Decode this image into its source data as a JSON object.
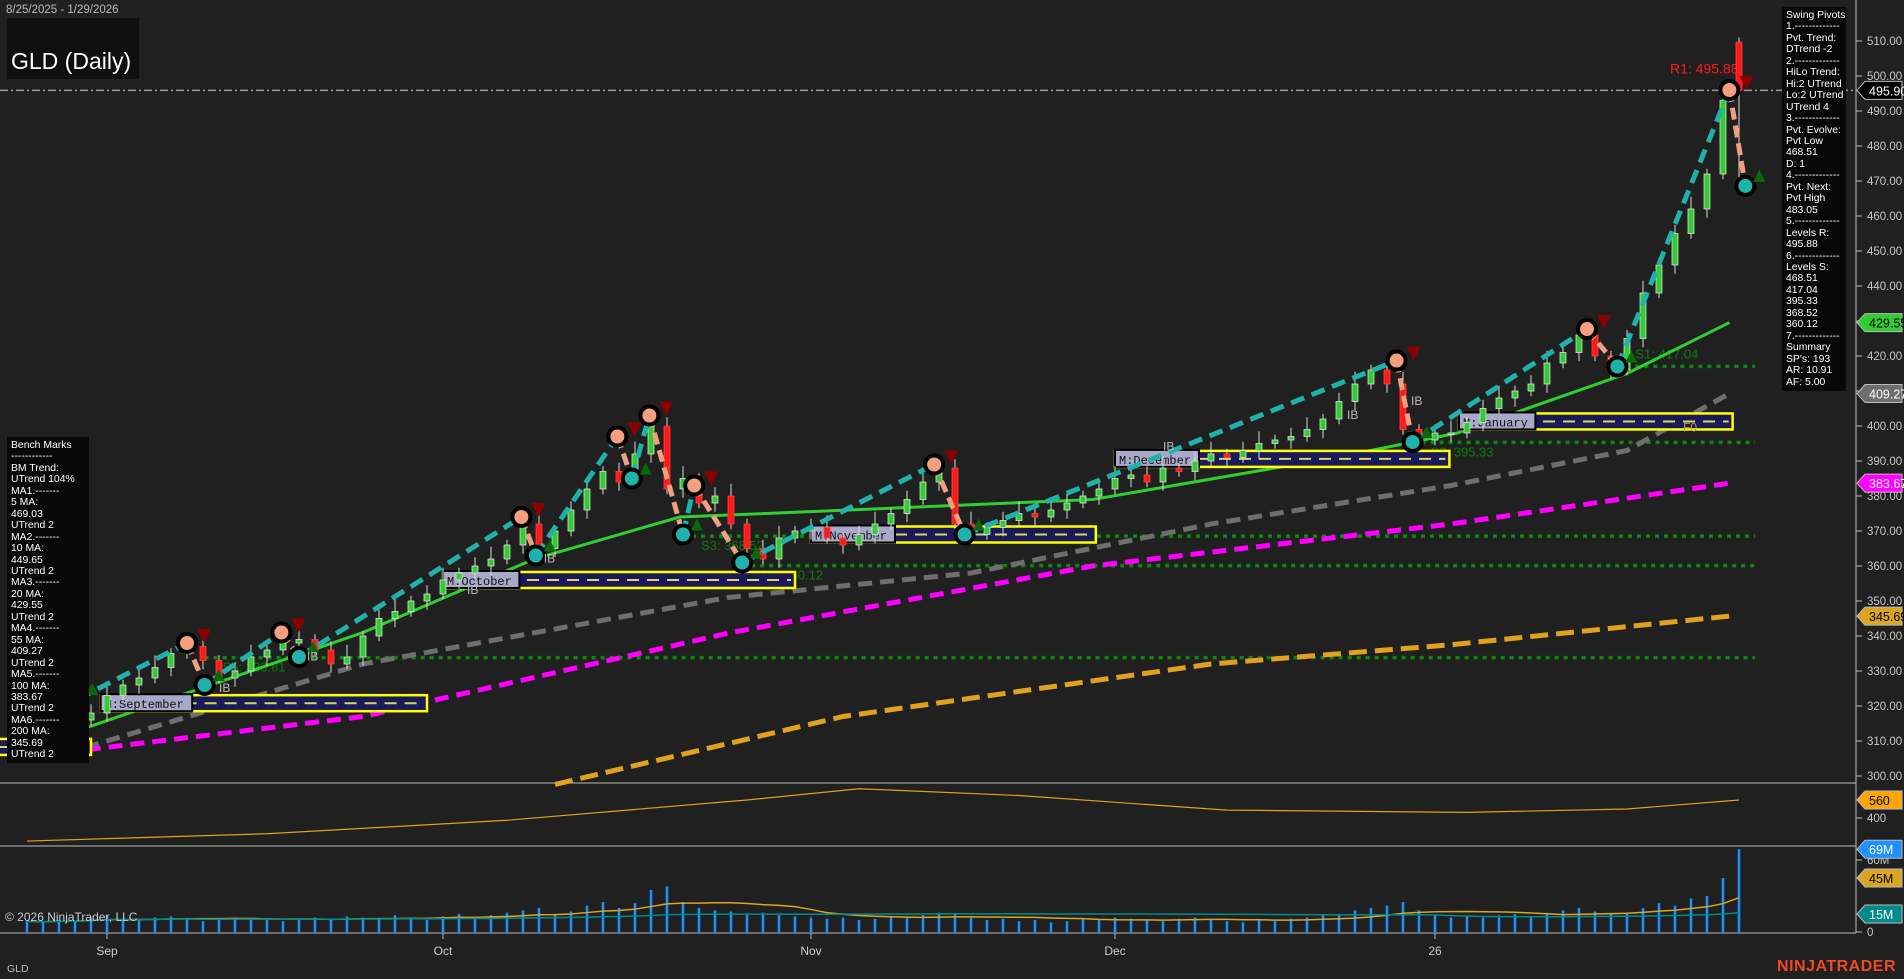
{
  "header": {
    "date_range": "8/25/2025 - 1/29/2026",
    "title": "GLD (Daily)"
  },
  "bench_marks": [
    "Bench Marks",
    "------------",
    "BM Trend:",
    "UTrend 104%",
    "MA1.-------",
    "5 MA:",
    "469.03",
    "UTrend 2",
    "MA2.-------",
    "10 MA:",
    "449.65",
    "UTrend 2",
    "MA3.-------",
    "20 MA:",
    "429.55",
    "UTrend 2",
    "MA4.-------",
    "55 MA:",
    "409.27",
    "UTrend 2",
    "MA5.-------",
    "100 MA:",
    "383.67",
    "UTrend 2",
    "MA6.-------",
    "200 MA:",
    "345.69",
    "UTrend 2"
  ],
  "swing_pivots": [
    "Swing Pivots",
    "1.-------------",
    "Pvt. Trend:",
    "DTrend -2",
    "2.-------------",
    "HiLo Trend:",
    "Hi:2 UTrend",
    "Lo:2 UTrend",
    "UTrend 4",
    "3.-------------",
    "Pvt. Evolve:",
    "Pvt Low",
    "468.51",
    "D: 1",
    "4.-------------",
    "Pvt. Next:",
    "Pvt High",
    "483.05",
    "5.-------------",
    "Levels R:",
    "495.88",
    "6.-------------",
    "Levels S:",
    "468.51",
    "417.04",
    "395.33",
    "368.52",
    "360.12",
    "7.-------------",
    "Summary",
    "SP's: 193",
    "AR: 10.91",
    "AF: 5.00"
  ],
  "footer": {
    "copyright": "© 2026 NinjaTrader, LLC",
    "symbol": "GLD",
    "logo": "NINJATRADER"
  },
  "chart_data": {
    "type": "candlestick",
    "symbol": "GLD",
    "interval": "Daily",
    "x_labels": [
      {
        "label": "Sep",
        "bar": 5
      },
      {
        "label": "Oct",
        "bar": 26
      },
      {
        "label": "Nov",
        "bar": 49
      },
      {
        "label": "Dec",
        "bar": 68
      },
      {
        "label": "26",
        "bar": 88
      }
    ],
    "price_axis": {
      "min": 300,
      "max": 510,
      "step": 10,
      "tick_labels": [
        "300.00",
        "310.00",
        "320.00",
        "330.00",
        "340.00",
        "350.00",
        "360.00",
        "370.00",
        "380.00",
        "390.00",
        "400.00",
        "410.00",
        "420.00",
        "430.00",
        "440.00",
        "450.00",
        "460.00",
        "470.00",
        "480.00",
        "490.00",
        "500.00",
        "510.00"
      ]
    },
    "closes": [
      312,
      313,
      314,
      316,
      318,
      323,
      326,
      328,
      331,
      335,
      337,
      333,
      328,
      330,
      334,
      336,
      338,
      339,
      336,
      332,
      334,
      340,
      345,
      347,
      350,
      352,
      356,
      358,
      360,
      362,
      366,
      372,
      365,
      370,
      376,
      382,
      387,
      384,
      392,
      400,
      382,
      385,
      378,
      380,
      372,
      365,
      362,
      368,
      370,
      371,
      368,
      366,
      369,
      372,
      375,
      379,
      384,
      388,
      372,
      369,
      371,
      373,
      375,
      374,
      376,
      378,
      380,
      382,
      385,
      386,
      384,
      388,
      387,
      390,
      392,
      391,
      393,
      395,
      396,
      397,
      399,
      402,
      407,
      412,
      416,
      412,
      399,
      396,
      398,
      398,
      401,
      405,
      408,
      410,
      412,
      418,
      421,
      426,
      420,
      416,
      425,
      438,
      446,
      455,
      462,
      472,
      493,
      496
    ],
    "last_bar": {
      "open": 509.7,
      "high": 511,
      "low": 468.51,
      "close": 495.9
    },
    "volume_millions": [
      9,
      8,
      10,
      9,
      12,
      14,
      11,
      10,
      12,
      13,
      11,
      9,
      10,
      12,
      11,
      10,
      9,
      11,
      12,
      10,
      13,
      12,
      11,
      14,
      12,
      10,
      13,
      15,
      12,
      14,
      16,
      18,
      20,
      15,
      17,
      22,
      25,
      20,
      24,
      35,
      38,
      25,
      20,
      18,
      17,
      15,
      16,
      14,
      13,
      12,
      11,
      12,
      10,
      11,
      13,
      12,
      14,
      16,
      15,
      12,
      10,
      11,
      9,
      10,
      8,
      9,
      11,
      10,
      12,
      11,
      10,
      9,
      11,
      12,
      10,
      9,
      8,
      10,
      9,
      11,
      12,
      14,
      15,
      18,
      20,
      22,
      25,
      18,
      14,
      12,
      13,
      12,
      14,
      15,
      13,
      16,
      18,
      20,
      17,
      15,
      16,
      20,
      24,
      22,
      28,
      30,
      45,
      69
    ],
    "moving_averages": [
      {
        "name": "20 MA",
        "color": "#32cd32",
        "dash": "",
        "value": "429.55",
        "points": [
          [
            1.3,
            310
          ],
          [
            21,
            341
          ],
          [
            31.7,
            362
          ],
          [
            40.8,
            374
          ],
          [
            51.4,
            376
          ],
          [
            66.6,
            379
          ],
          [
            81.8,
            391
          ],
          [
            89.4,
            398
          ],
          [
            100,
            415
          ],
          [
            106.4,
            429.55
          ]
        ]
      },
      {
        "name": "55 MA",
        "color": "#6e6e6e",
        "dash": "14 8",
        "value": "409.27",
        "points": [
          [
            1,
            304.5
          ],
          [
            21,
            332
          ],
          [
            43.8,
            351
          ],
          [
            59,
            358
          ],
          [
            74,
            372
          ],
          [
            89,
            383
          ],
          [
            100,
            393
          ],
          [
            106.4,
            409.27
          ]
        ]
      },
      {
        "name": "100 MA",
        "color": "#ff00ff",
        "dash": "14 8",
        "value": "383.67",
        "points": [
          [
            1,
            306
          ],
          [
            21,
            317
          ],
          [
            44,
            341
          ],
          [
            66.6,
            360
          ],
          [
            89,
            372
          ],
          [
            106.4,
            383.67
          ]
        ]
      },
      {
        "name": "200 MA",
        "color": "#e0a020",
        "dash": "18 8",
        "value": "345.69",
        "points": [
          [
            33,
            297.6
          ],
          [
            51,
            317
          ],
          [
            74,
            332
          ],
          [
            89,
            337.5
          ],
          [
            106.4,
            345.69
          ]
        ]
      }
    ],
    "swing_pivots": [
      [
        3.2,
        322,
        "L"
      ],
      [
        10,
        338,
        "H"
      ],
      [
        11.1,
        326,
        "L"
      ],
      [
        15.9,
        341,
        "H"
      ],
      [
        17,
        334,
        "L"
      ],
      [
        30.9,
        374,
        "H"
      ],
      [
        31.8,
        363,
        "L"
      ],
      [
        36.9,
        397,
        "H"
      ],
      [
        37.8,
        385,
        "L"
      ],
      [
        38.9,
        403,
        "H"
      ],
      [
        41,
        369,
        "L"
      ],
      [
        41.7,
        383,
        "H"
      ],
      [
        44.7,
        361,
        "L"
      ],
      [
        56.7,
        389,
        "H"
      ],
      [
        58.6,
        369,
        "L"
      ],
      [
        85.6,
        418.7,
        "H"
      ],
      [
        86.6,
        395.4,
        "L"
      ],
      [
        97.5,
        427.7,
        "H"
      ],
      [
        99.4,
        417,
        "L"
      ],
      [
        106.4,
        496,
        "H"
      ],
      [
        107.4,
        468.6,
        "L"
      ]
    ],
    "support_levels": [
      {
        "label": "S1: 417.04",
        "price": 417.04,
        "from_bar": 99.4
      },
      {
        "label": "S2: 395.33",
        "price": 395.33,
        "from_bar": 86.6
      },
      {
        "label": "S3: 368.52",
        "price": 368.52,
        "from_bar": 41
      },
      {
        "label": "S4: 360.12",
        "price": 360.12,
        "from_bar": 44.7
      },
      {
        "label": "S5: 333.81",
        "price": 333.81,
        "from_bar": 11.1
      }
    ],
    "resistance": {
      "label": "R1: 495.88",
      "price": 495.88
    },
    "current_price": "495.90",
    "monthly_boxes": [
      {
        "label": "",
        "from": -2,
        "to": 4,
        "price": 308.3
      },
      {
        "label": "M:September",
        "from": 4.6,
        "to": 25,
        "price": 320.8
      },
      {
        "label": "M:October",
        "from": 26,
        "to": 48,
        "price": 356
      },
      {
        "label": "M:November",
        "from": 49,
        "to": 66.8,
        "price": 369
      },
      {
        "label": "M:December",
        "from": 68,
        "to": 88.9,
        "price": 390.6
      },
      {
        "label": "M:January",
        "from": 89.5,
        "to": 106.6,
        "price": 401.3
      }
    ],
    "annotations": [
      {
        "text": "IB",
        "bar": 12,
        "price": 324
      },
      {
        "text": "IB",
        "bar": 17.5,
        "price": 333
      },
      {
        "text": "IB",
        "bar": 32.3,
        "price": 361
      },
      {
        "text": "IB",
        "bar": 27.5,
        "price": 352
      },
      {
        "text": "IB",
        "bar": 71,
        "price": 393
      },
      {
        "text": "IB",
        "bar": 82.5,
        "price": 402
      },
      {
        "text": "IB",
        "bar": 86.5,
        "price": 406
      },
      {
        "text": "F0",
        "bar": 103.5,
        "price": 398.5
      }
    ],
    "oscillator": {
      "value": "560",
      "tick": "400",
      "points": [
        [
          0,
          195
        ],
        [
          15,
          260
        ],
        [
          30,
          380
        ],
        [
          45,
          560
        ],
        [
          52,
          660
        ],
        [
          62,
          600
        ],
        [
          75,
          470
        ],
        [
          90,
          450
        ],
        [
          100,
          480
        ],
        [
          107,
          560
        ]
      ]
    },
    "volume_axis": {
      "ticks": [
        "60M",
        "0"
      ],
      "tags": [
        {
          "value": "69M",
          "color": "#1e90ff"
        },
        {
          "value": "45M",
          "color": "#daa520"
        },
        {
          "value": "15M",
          "color": "#008b8b"
        }
      ]
    },
    "price_tags": [
      {
        "value": "495.90",
        "bg": "#000000",
        "fg": "#ffffff"
      },
      {
        "value": "429.55",
        "bg": "#32cd32",
        "fg": "#000000"
      },
      {
        "value": "409.27",
        "bg": "#6e6e6e",
        "fg": "#ffffff"
      },
      {
        "value": "383.67",
        "bg": "#ff00ff",
        "fg": "#ffffff"
      },
      {
        "value": "345.69",
        "bg": "#daa520",
        "fg": "#000000"
      }
    ]
  }
}
